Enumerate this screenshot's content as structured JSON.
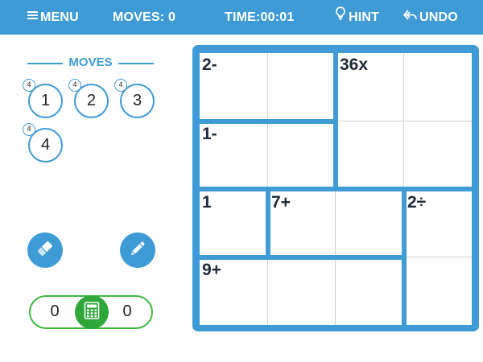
{
  "topbar": {
    "menu_label": "MENU",
    "moves_label": "MOVES: 0",
    "time_label": "TIME:",
    "time_value": "00:01",
    "hint_label": "HINT",
    "undo_label": "UNDO"
  },
  "moves_panel": {
    "heading": "MOVES",
    "buttons": [
      {
        "value": "1",
        "badge": "4"
      },
      {
        "value": "2",
        "badge": "4"
      },
      {
        "value": "3",
        "badge": "4"
      },
      {
        "value": "4",
        "badge": "4"
      }
    ]
  },
  "tools": {
    "eraser_icon": "eraser-icon",
    "pencil_icon": "pencil-icon"
  },
  "counter": {
    "left_value": "0",
    "right_value": "0",
    "icon": "calculator-icon"
  },
  "board": {
    "size": 4,
    "clues": [
      {
        "row": 0,
        "col": 0,
        "text": "2-"
      },
      {
        "row": 0,
        "col": 2,
        "text": "36x"
      },
      {
        "row": 1,
        "col": 0,
        "text": "1-"
      },
      {
        "row": 2,
        "col": 0,
        "text": "1"
      },
      {
        "row": 2,
        "col": 1,
        "text": "7+"
      },
      {
        "row": 2,
        "col": 3,
        "text": "2÷"
      },
      {
        "row": 3,
        "col": 0,
        "text": "9+"
      }
    ]
  },
  "colors": {
    "primary": "#3f9bd6",
    "green": "#2fa73a",
    "grid_line": "#cfcfcf"
  }
}
